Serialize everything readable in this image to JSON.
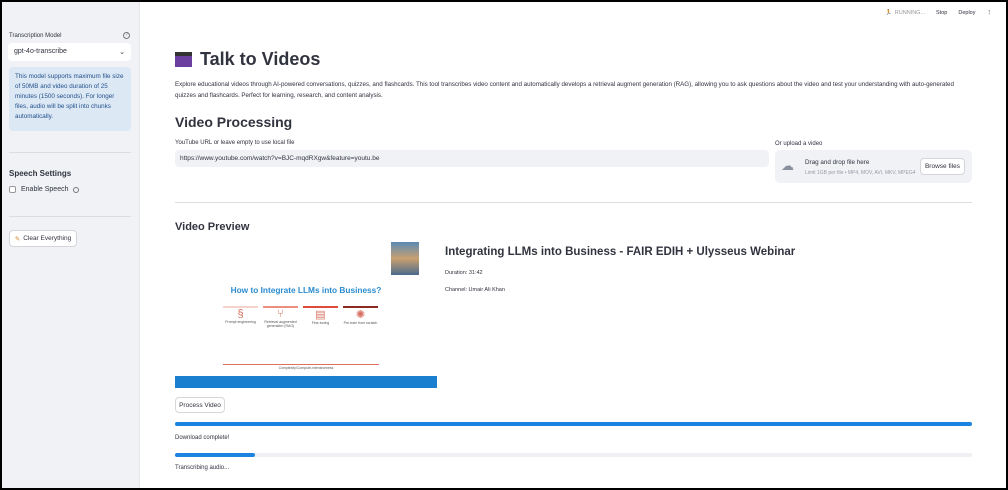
{
  "header": {
    "status": "RUNNING...",
    "stop": "Stop",
    "deploy": "Deploy"
  },
  "sidebar": {
    "model_label": "Transcription Model",
    "model_value": "gpt-4o-transcribe",
    "info": "This model supports maximum file size of 50MB and video duration of 25 minutes (1500 seconds). For longer files, audio will be split into chunks automatically.",
    "speech_title": "Speech Settings",
    "enable_speech": "Enable Speech",
    "enable_speech_checked": false,
    "clear_label": "Clear Everything"
  },
  "main": {
    "title": "Talk to Videos",
    "description": "Explore educational videos through AI-powered conversations, quizzes, and flashcards. This tool transcribes video content and automatically develops a retrieval augment generation (RAG), allowing you to ask questions about the video and test your understanding with auto-generated quizzes and flashcards. Perfect for learning, research, and content analysis.",
    "processing_title": "Video Processing",
    "url_label": "YouTube URL or leave empty to use local file",
    "url_value": "https://www.youtube.com/watch?v=BJC-mqdRXgw&feature=youtu.be",
    "upload_label": "Or upload a video",
    "drop_text": "Drag and drop file here",
    "drop_limit": "Limit 1GB per file • MP4, MOV, AVI, MKV, MPEG4",
    "browse": "Browse files",
    "preview_title": "Video Preview",
    "thumb_heading": "How to Integrate LLMs into Business?",
    "thumb_items": [
      "Prompt engineering",
      "Retrieval augmented generation (RAG)",
      "Fine-tuning",
      "Pre-train from scratch"
    ],
    "thumb_axis": "Complexity/Compute-intensiveness",
    "video_title": "Integrating LLMs into Business - FAIR EDIH + Ulysseus Webinar",
    "duration": "Duration: 31:42",
    "channel": "Channel: Umair Ali Khan",
    "process_button": "Process Video",
    "progress1": 100,
    "status1": "Download complete!",
    "progress2": 10,
    "status2": "Transcribing audio...",
    "accent": "#1c83e1"
  }
}
